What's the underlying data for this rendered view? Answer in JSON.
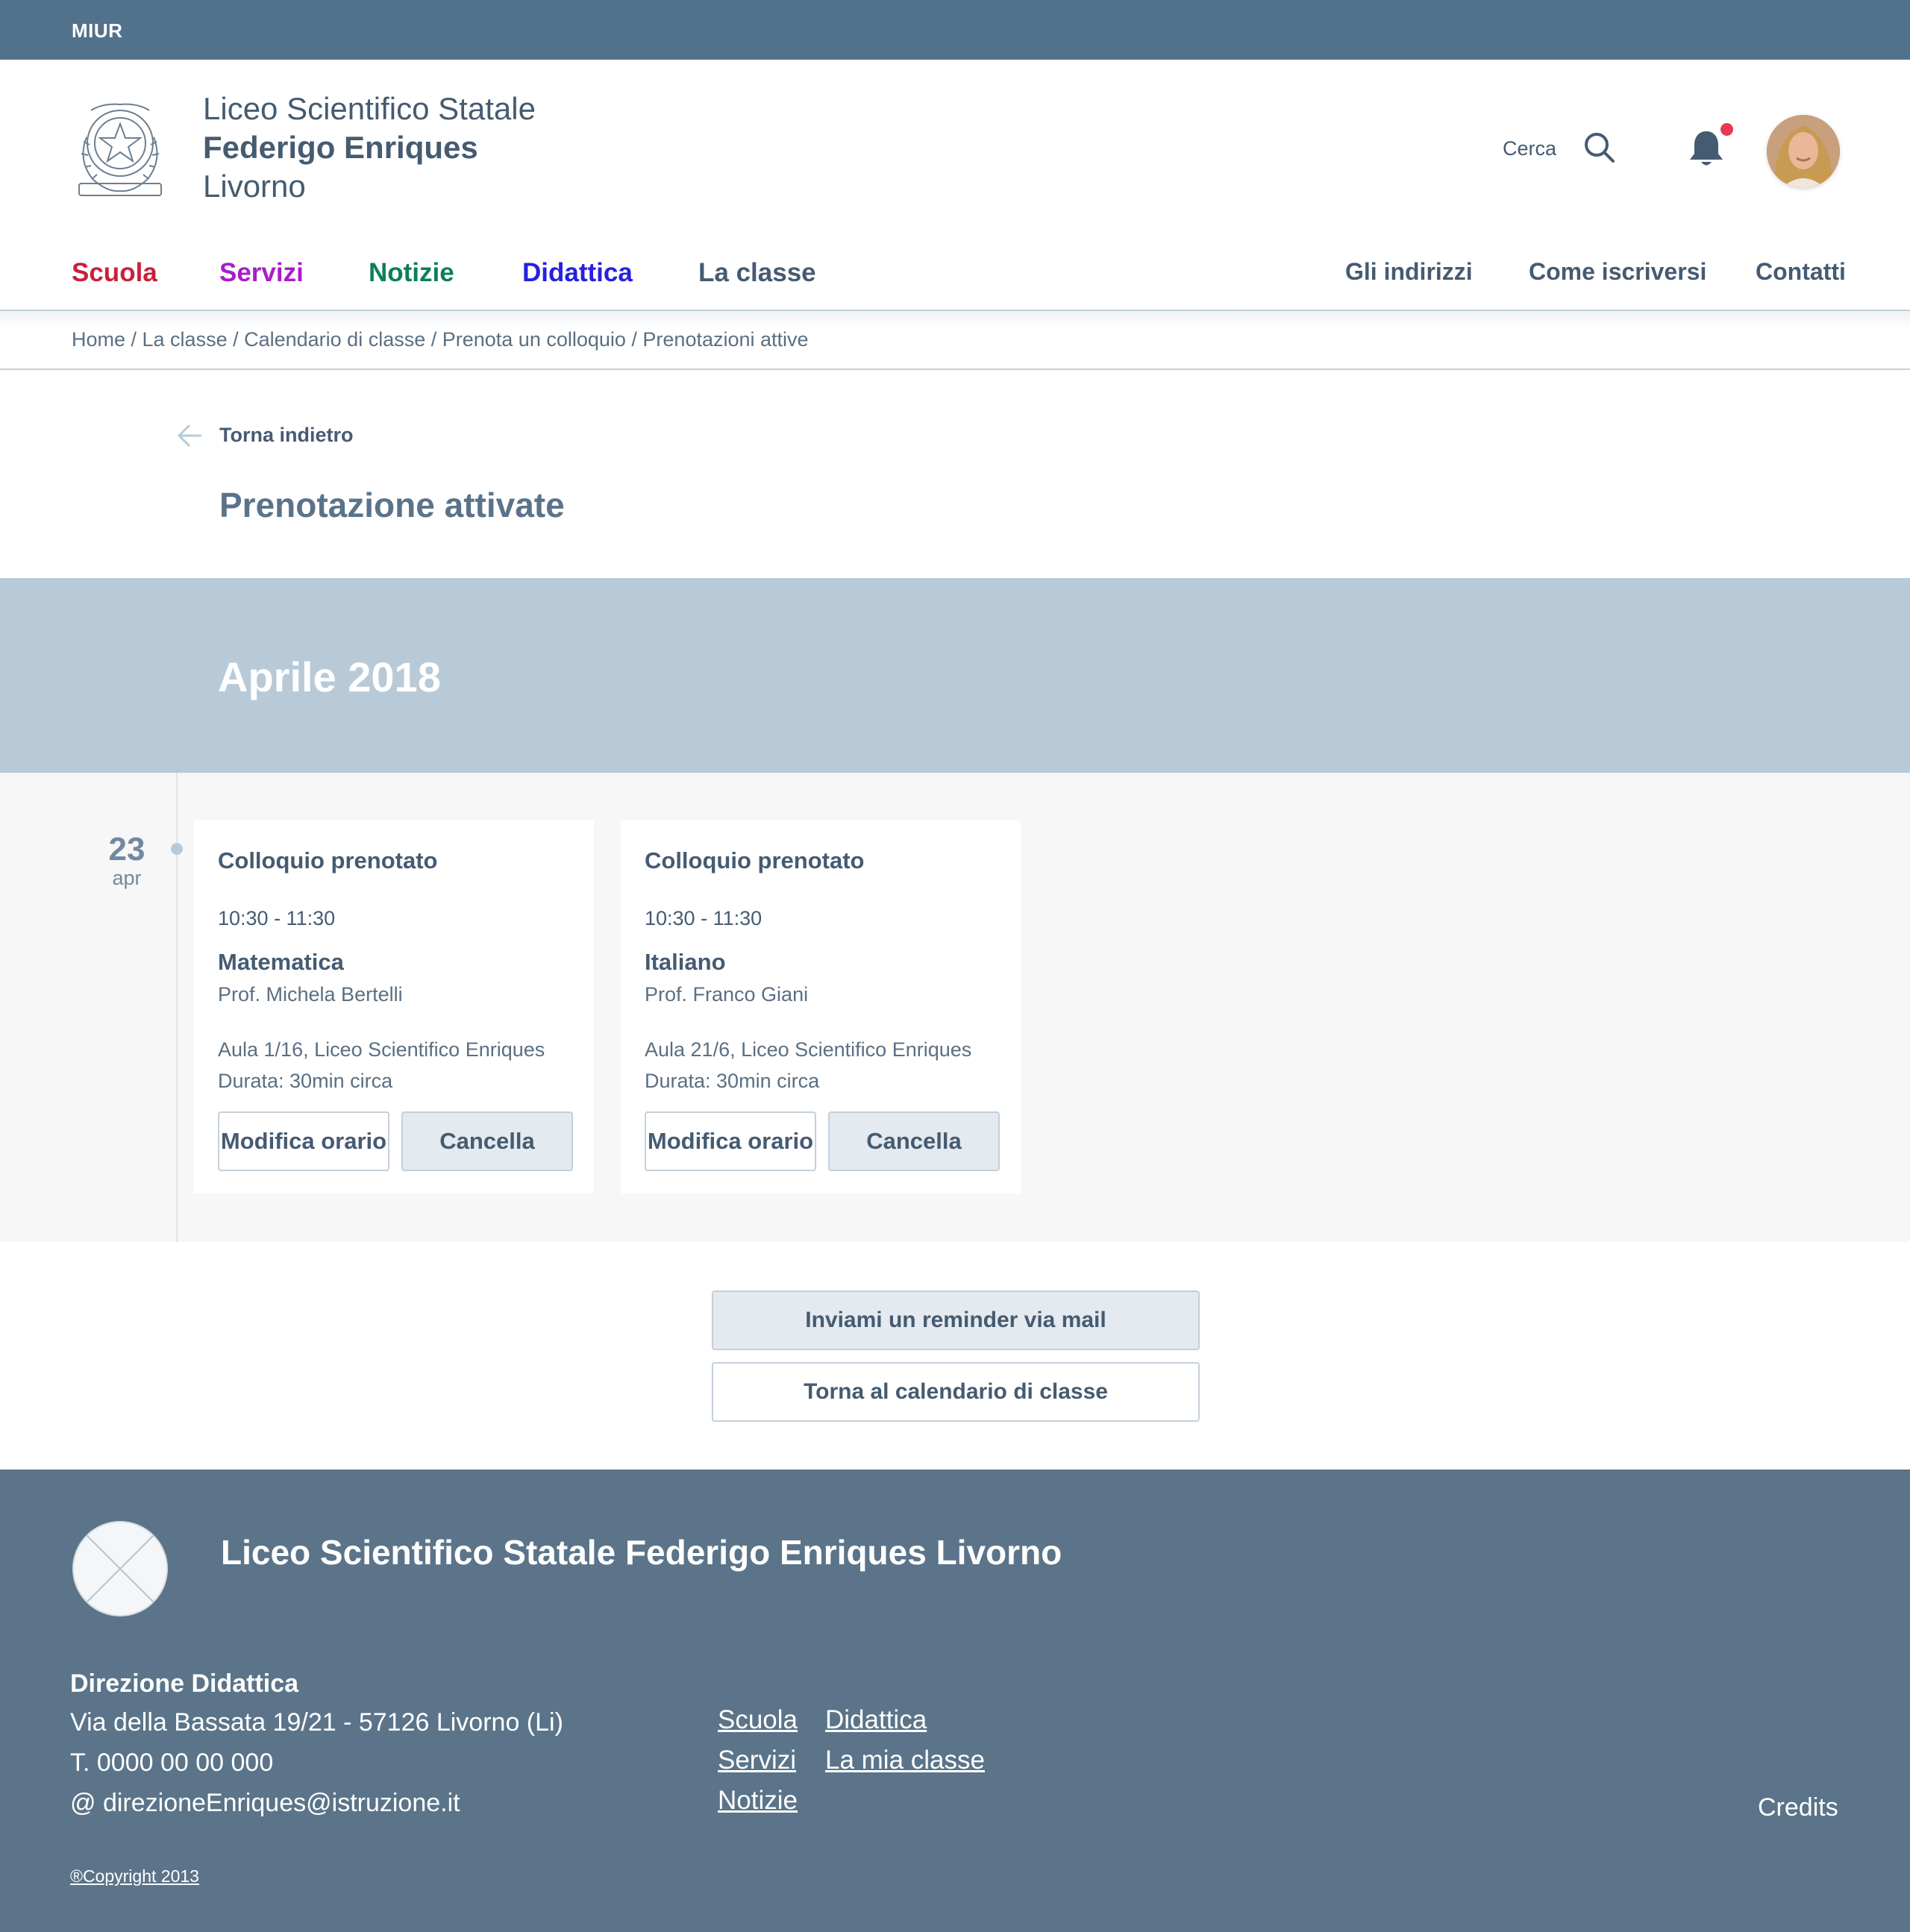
{
  "topbar": {
    "brand": "MIUR"
  },
  "header": {
    "school_line1": "Liceo Scientifico Statale",
    "school_line2": "Federigo Enriques",
    "school_line3": "Livorno",
    "search_label": "Cerca",
    "icons": {
      "search": "search-icon",
      "notifications": "bell-icon",
      "avatar": "user-avatar"
    }
  },
  "nav": {
    "items": [
      {
        "label": "Scuola",
        "color": "#c8213b"
      },
      {
        "label": "Servizi",
        "color": "#a91dc9"
      },
      {
        "label": "Notizie",
        "color": "#0b7f5a"
      },
      {
        "label": "Didattica",
        "color": "#2620e0"
      },
      {
        "label": "La classe",
        "color": "#455b71"
      }
    ],
    "right_items": [
      {
        "label": "Gli indirizzi"
      },
      {
        "label": "Come iscriversi"
      },
      {
        "label": "Contatti"
      }
    ]
  },
  "breadcrumb": {
    "text": "Home / La classe / Calendario di classe / Prenota un colloquio / Prenotazioni attive"
  },
  "back": {
    "label": "Torna indietro"
  },
  "page_title": "Prenotazione attivate",
  "month": "Aprile 2018",
  "day": {
    "number": "23",
    "month": "apr"
  },
  "cards": [
    {
      "title": "Colloquio prenotato",
      "time": "10:30 - 11:30",
      "subject": "Matematica",
      "professor": "Prof. Michela Bertelli",
      "room": "Aula 1/16, Liceo Scientifico Enriques",
      "duration": "Durata: 30min circa",
      "modify_label": "Modifica orario",
      "cancel_label": "Cancella"
    },
    {
      "title": "Colloquio prenotato",
      "time": "10:30 - 11:30",
      "subject": "Italiano",
      "professor": "Prof. Franco Giani",
      "room": "Aula 21/6, Liceo Scientifico Enriques",
      "duration": "Durata: 30min circa",
      "modify_label": "Modifica orario",
      "cancel_label": "Cancella"
    }
  ],
  "actions": {
    "reminder_label": "Inviami un reminder via mail",
    "back_calendar_label": "Torna al calendario di classe"
  },
  "footer": {
    "title": "Liceo Scientifico Statale Federigo Enriques Livorno",
    "direction": "Direzione Didattica",
    "address": "Via della Bassata 19/21 - 57126 Livorno (Li)",
    "phone": "T. 0000 00 00 000",
    "email": "@ direzioneEnriques@istruzione.it",
    "links_col1": [
      "Scuola",
      "Servizi",
      "Notizie"
    ],
    "links_col2": [
      "Didattica",
      "La mia classe"
    ],
    "credits": "Credits",
    "copyright": "®Copyright 2013"
  },
  "colors": {
    "topbar": "#52718b",
    "month_band": "#b8cad8",
    "footer": "#5b7489",
    "text": "#455b71",
    "notification_dot": "#e63b53"
  }
}
